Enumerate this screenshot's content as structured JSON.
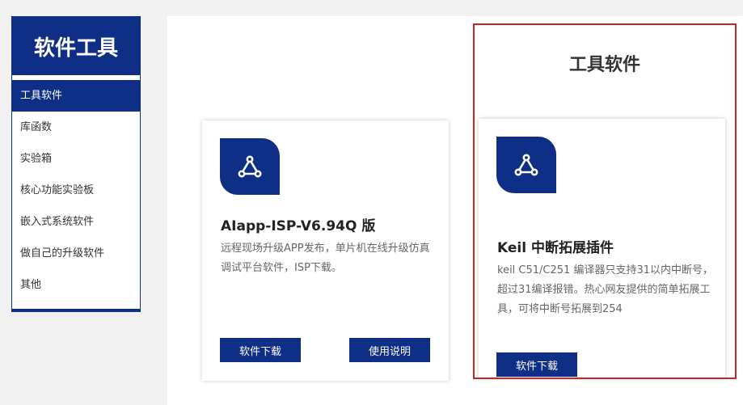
{
  "sidebar": {
    "title": "软件工具",
    "items": [
      {
        "label": "工具软件",
        "active": true
      },
      {
        "label": "库函数"
      },
      {
        "label": "实验箱"
      },
      {
        "label": "核心功能实验板"
      },
      {
        "label": "嵌入式系统软件"
      },
      {
        "label": "做自己的升级软件"
      },
      {
        "label": "其他"
      }
    ]
  },
  "section": {
    "title": "工具软件"
  },
  "cards": [
    {
      "icon": "webhook-icon",
      "title": "AIapp-ISP-V6.94Q 版",
      "description": "远程现场升级APP发布，单片机在线升级仿真调试平台软件，ISP下载。",
      "download_label": "软件下载",
      "manual_label": "使用说明"
    },
    {
      "icon": "webhook-icon",
      "title": "Keil 中断拓展插件",
      "description": "keil C51/C251 编译器只支持31以内中断号，超过31编译报错。热心网友提供的简单拓展工具，可将中断号拓展到254",
      "download_label": "软件下载"
    }
  ],
  "colors": {
    "brand": "#0f2f86",
    "highlight": "#c8242c"
  }
}
